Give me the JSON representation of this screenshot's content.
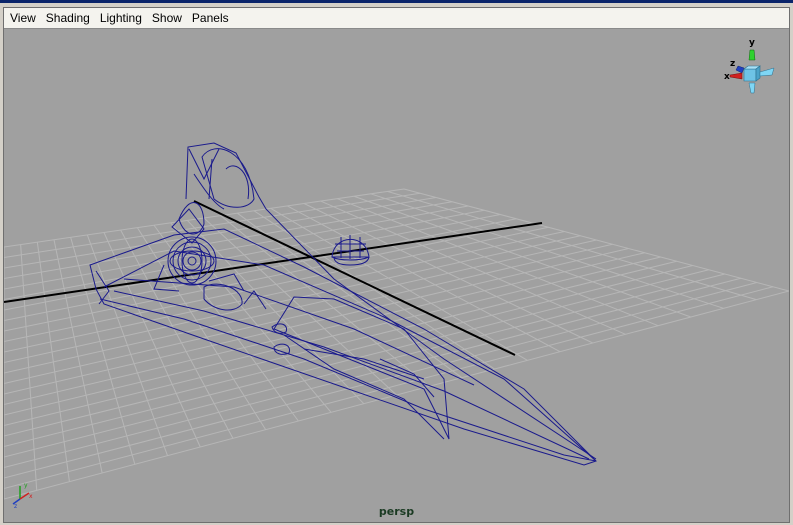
{
  "menu": {
    "items": [
      {
        "label": "View"
      },
      {
        "label": "Shading"
      },
      {
        "label": "Lighting"
      },
      {
        "label": "Show"
      },
      {
        "label": "Panels"
      }
    ]
  },
  "viewport": {
    "camera_label": "persp",
    "background_color": "#a0a0a0",
    "grid_color": "#b6b6b6",
    "axis_color": "#000000",
    "wireframe_color": "#1a1a8c"
  },
  "view_cube": {
    "icon": "view-cube-icon",
    "axis_labels": {
      "y": "y",
      "x": "x",
      "z": "z"
    }
  },
  "axis_indicator": {
    "icon": "world-axis-icon"
  }
}
